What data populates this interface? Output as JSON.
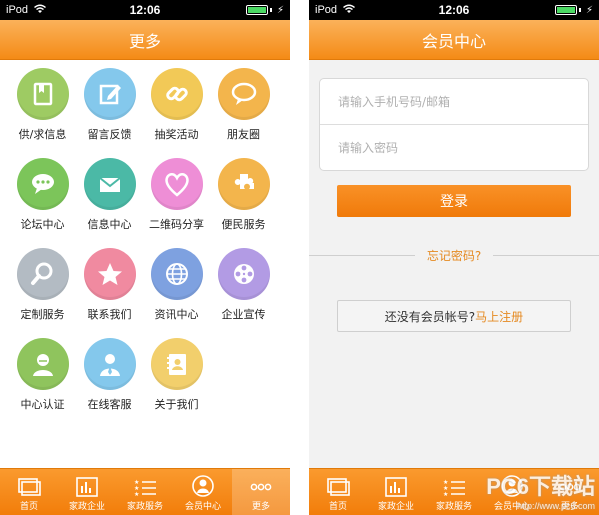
{
  "status": {
    "carrier": "iPod",
    "time": "12:06"
  },
  "more_screen": {
    "title": "更多",
    "items": [
      {
        "label": "供/求信息",
        "icon": "book-icon",
        "color": "#9ecb63"
      },
      {
        "label": "留言反馈",
        "icon": "note-edit-icon",
        "color": "#84c8ec"
      },
      {
        "label": "抽奖活动",
        "icon": "chain-link-icon",
        "color": "#f2c957"
      },
      {
        "label": "朋友圈",
        "icon": "speech-bubble-icon",
        "color": "#f3b54c"
      },
      {
        "label": "论坛中心",
        "icon": "chat-bubble-icon",
        "color": "#7cc55a"
      },
      {
        "label": "信息中心",
        "icon": "envelope-icon",
        "color": "#4bb9a6"
      },
      {
        "label": "二维码分享",
        "icon": "heart-icon",
        "color": "#ee8ed6"
      },
      {
        "label": "便民服务",
        "icon": "puzzle-icon",
        "color": "#f3b54c"
      },
      {
        "label": "定制服务",
        "icon": "magnifier-icon",
        "color": "#b3bbc3"
      },
      {
        "label": "联系我们",
        "icon": "star-icon",
        "color": "#f08aa0"
      },
      {
        "label": "资讯中心",
        "icon": "globe-icon",
        "color": "#7ea1e0"
      },
      {
        "label": "企业宣传",
        "icon": "film-reel-icon",
        "color": "#b29be4"
      },
      {
        "label": "中心认证",
        "icon": "person-icon",
        "color": "#8fc45d"
      },
      {
        "label": "在线客服",
        "icon": "support-agent-icon",
        "color": "#84c8ec"
      },
      {
        "label": "关于我们",
        "icon": "contact-card-icon",
        "color": "#f2cf6c"
      }
    ]
  },
  "member_screen": {
    "title": "会员中心",
    "phone_placeholder": "请输入手机号码/邮箱",
    "password_placeholder": "请输入密码",
    "login_label": "登录",
    "forgot_label": "忘记密码?",
    "register_prompt": "还没有会员帐号?",
    "register_link": "马上注册"
  },
  "tabs": [
    {
      "label": "首页",
      "icon": "home-screen-icon"
    },
    {
      "label": "家政企业",
      "icon": "bar-chart-icon"
    },
    {
      "label": "家政服务",
      "icon": "list-star-icon"
    },
    {
      "label": "会员中心",
      "icon": "member-icon"
    },
    {
      "label": "更多",
      "icon": "more-dots-icon"
    }
  ],
  "left_active_tab": "更多",
  "watermark": {
    "text": "PC6下载站",
    "url": "http://www.pc6.com"
  }
}
